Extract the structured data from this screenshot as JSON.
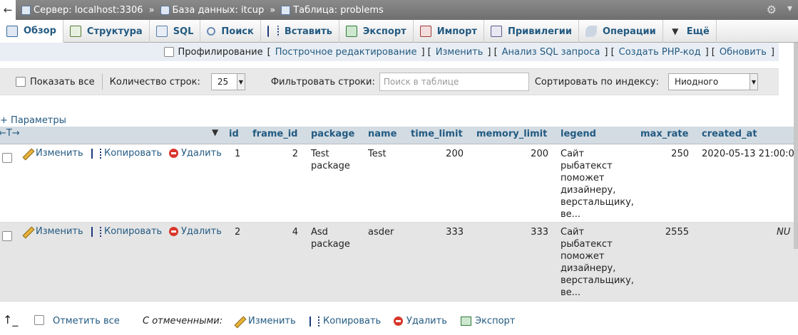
{
  "topbar": {
    "server": "Сервер: localhost:3306",
    "database": "База данных: itcup",
    "table": "Таблица: problems",
    "sep": "»"
  },
  "tabs": [
    {
      "label": "Обзор",
      "icon": "browse-icon"
    },
    {
      "label": "Структура",
      "icon": "structure-icon"
    },
    {
      "label": "SQL",
      "icon": "sql-icon"
    },
    {
      "label": "Поиск",
      "icon": "search-icon"
    },
    {
      "label": "Вставить",
      "icon": "insert-icon"
    },
    {
      "label": "Экспорт",
      "icon": "export-icon"
    },
    {
      "label": "Импорт",
      "icon": "import-icon"
    },
    {
      "label": "Привилегии",
      "icon": "privileges-icon"
    },
    {
      "label": "Операции",
      "icon": "operations-icon"
    },
    {
      "label": "Ещё",
      "icon": "more-icon"
    }
  ],
  "profiling": {
    "label": "Профилирование",
    "links": [
      "Построчное редактирование",
      "Изменить",
      "Анализ SQL запроса",
      "Создать PHP-код",
      "Обновить"
    ]
  },
  "nav": {
    "show_all": "Показать все",
    "rows_label": "Количество строк:",
    "rows_value": "25",
    "filter_label": "Фильтровать строки:",
    "filter_placeholder": "Поиск в таблице",
    "sort_label": "Сортировать по индексу:",
    "sort_value": "Ниодного"
  },
  "params_label": "Параметры",
  "columns": [
    "id",
    "frame_id",
    "package",
    "name",
    "time_limit",
    "memory_limit",
    "legend",
    "max_rate",
    "created_at"
  ],
  "actions": {
    "edit": "Изменить",
    "copy": "Копировать",
    "delete": "Удалить"
  },
  "rows": [
    {
      "id": "1",
      "frame_id": "2",
      "package": [
        "Test",
        "package"
      ],
      "name": "Test",
      "time_limit": "200",
      "memory_limit": "200",
      "legend": [
        "Сайт",
        "рыбатекст",
        "поможет",
        "дизайнеру,",
        "верстальщику,",
        "ве..."
      ],
      "max_rate": "250",
      "created_at": "2020-05-13 21:00:0"
    },
    {
      "id": "2",
      "frame_id": "4",
      "package": [
        "Asd",
        "package"
      ],
      "name": "asder",
      "time_limit": "333",
      "memory_limit": "333",
      "legend": [
        "Сайт",
        "рыбатекст",
        "поможет",
        "дизайнеру,",
        "верстальщику,",
        "ве..."
      ],
      "max_rate": "2555",
      "created_at": "NU"
    }
  ],
  "bottom": {
    "check_all": "Отметить все",
    "with_selected": "С отмеченными:",
    "edit": "Изменить",
    "copy": "Копировать",
    "delete": "Удалить",
    "export": "Экспорт"
  }
}
